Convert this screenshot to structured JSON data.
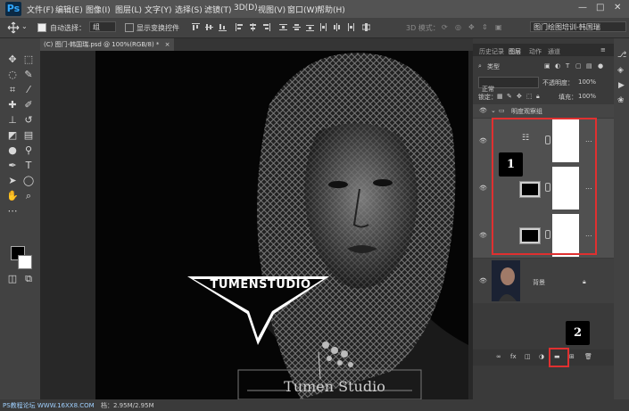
{
  "app": {
    "logo": "Ps"
  },
  "menu": [
    "文件(F)",
    "编辑(E)",
    "图像(I)",
    "图层(L)",
    "文字(Y)",
    "选择(S)",
    "滤镜(T)",
    "3D(D)",
    "视图(V)",
    "窗口(W)",
    "帮助(H)"
  ],
  "window_controls": {
    "minimize": "—",
    "maximize": "□",
    "close": "✕"
  },
  "options": {
    "auto_select_label": "自动选择：",
    "auto_select_value": "组",
    "show_transform_label": "显示变换控件",
    "mode_3d_label": "3D 模式：",
    "workspace_value": "图门绘图培训-韩国瑞"
  },
  "document": {
    "tab_title": "(C) 图门-韩国瑞.psd @ 100%(RGB/8) *",
    "tab_close": "×"
  },
  "canvas": {
    "logo_text": "TUMENSTUDIO",
    "signature_text": "Tumen Studio"
  },
  "panel": {
    "tabs": [
      "历史记录",
      "图层",
      "动作",
      "通道"
    ],
    "active_tab": "图层",
    "filter_kind": "类型",
    "blend_mode": "正常",
    "opacity_label": "不透明度：",
    "opacity_value": "100%",
    "lock_label": "锁定：",
    "fill_label": "填充：",
    "fill_value": "100%",
    "group_name": "明度观察组",
    "background_layer": "背景",
    "more": "..."
  },
  "callouts": {
    "one": "1",
    "two": "2"
  },
  "status": {
    "doc_size": "档：2.95M/2.95M",
    "watermark": "PS教程论坛  WWW.16XX8.COM"
  },
  "colors": {
    "accent": "#31a8ff",
    "highlight": "#e03030",
    "panel": "#3a3a3a"
  }
}
